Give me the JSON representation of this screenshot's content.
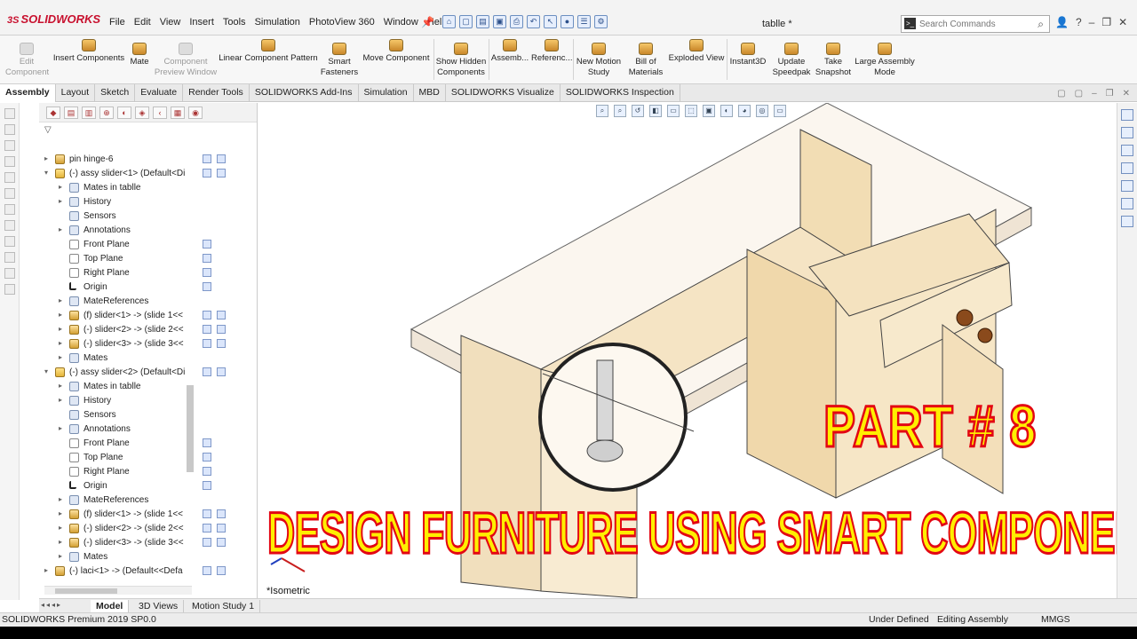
{
  "app": {
    "logo": "SOLIDWORKS",
    "menu": [
      "File",
      "Edit",
      "View",
      "Insert",
      "Tools",
      "Simulation",
      "PhotoView 360",
      "Window",
      "Help"
    ],
    "doc_title": "tablle *",
    "search_placeholder": "Search Commands"
  },
  "ribbon": {
    "edit_component": "Edit\nComponent",
    "insert_components": "Insert Components",
    "mate": "Mate",
    "component_preview": "Component\nPreview Window",
    "linear_pattern": "Linear Component Pattern",
    "smart_fasteners": "Smart\nFasteners",
    "move_component": "Move Component",
    "show_hidden": "Show Hidden\nComponents",
    "assembly": "Assemb...",
    "reference": "Referenc...",
    "new_motion": "New Motion\nStudy",
    "bom": "Bill of\nMaterials",
    "exploded_view": "Exploded View",
    "instant3d": "Instant3D",
    "update_speedpak": "Update\nSpeedpak",
    "take_snapshot": "Take\nSnapshot",
    "large_assembly": "Large Assembly\nMode"
  },
  "tabs": [
    "Assembly",
    "Layout",
    "Sketch",
    "Evaluate",
    "Render Tools",
    "SOLIDWORKS Add-Ins",
    "Simulation",
    "MBD",
    "SOLIDWORKS Visualize",
    "SOLIDWORKS Inspection"
  ],
  "tree": [
    {
      "label": "pin hinge-6",
      "indent": 0,
      "icon": "part",
      "tw": "▸"
    },
    {
      "label": "(-) assy slider<1> (Default<Di",
      "indent": 0,
      "icon": "asm",
      "tw": "▾"
    },
    {
      "label": "Mates in tablle",
      "indent": 1,
      "icon": "folder",
      "tw": "▸"
    },
    {
      "label": "History",
      "indent": 1,
      "icon": "folder",
      "tw": "▸"
    },
    {
      "label": "Sensors",
      "indent": 1,
      "icon": "folder",
      "tw": ""
    },
    {
      "label": "Annotations",
      "indent": 1,
      "icon": "folder",
      "tw": "▸"
    },
    {
      "label": "Front Plane",
      "indent": 1,
      "icon": "plane",
      "tw": ""
    },
    {
      "label": "Top Plane",
      "indent": 1,
      "icon": "plane",
      "tw": ""
    },
    {
      "label": "Right Plane",
      "indent": 1,
      "icon": "plane",
      "tw": ""
    },
    {
      "label": "Origin",
      "indent": 1,
      "icon": "origin",
      "tw": ""
    },
    {
      "label": "MateReferences",
      "indent": 1,
      "icon": "folder",
      "tw": "▸"
    },
    {
      "label": "(f) slider<1> -> (slide 1<<",
      "indent": 1,
      "icon": "part",
      "tw": "▸"
    },
    {
      "label": "(-) slider<2> -> (slide 2<<",
      "indent": 1,
      "icon": "part",
      "tw": "▸"
    },
    {
      "label": "(-) slider<3> -> (slide 3<<",
      "indent": 1,
      "icon": "part",
      "tw": "▸"
    },
    {
      "label": "Mates",
      "indent": 1,
      "icon": "folder",
      "tw": "▸"
    },
    {
      "label": "(-) assy slider<2> (Default<Di",
      "indent": 0,
      "icon": "asm",
      "tw": "▾"
    },
    {
      "label": "Mates in tablle",
      "indent": 1,
      "icon": "folder",
      "tw": "▸"
    },
    {
      "label": "History",
      "indent": 1,
      "icon": "folder",
      "tw": "▸"
    },
    {
      "label": "Sensors",
      "indent": 1,
      "icon": "folder",
      "tw": ""
    },
    {
      "label": "Annotations",
      "indent": 1,
      "icon": "folder",
      "tw": "▸"
    },
    {
      "label": "Front Plane",
      "indent": 1,
      "icon": "plane",
      "tw": ""
    },
    {
      "label": "Top Plane",
      "indent": 1,
      "icon": "plane",
      "tw": ""
    },
    {
      "label": "Right Plane",
      "indent": 1,
      "icon": "plane",
      "tw": ""
    },
    {
      "label": "Origin",
      "indent": 1,
      "icon": "origin",
      "tw": ""
    },
    {
      "label": "MateReferences",
      "indent": 1,
      "icon": "folder",
      "tw": "▸"
    },
    {
      "label": "(f) slider<1> -> (slide 1<<",
      "indent": 1,
      "icon": "part",
      "tw": "▸"
    },
    {
      "label": "(-) slider<2> -> (slide 2<<",
      "indent": 1,
      "icon": "part",
      "tw": "▸"
    },
    {
      "label": "(-) slider<3> -> (slide 3<<",
      "indent": 1,
      "icon": "part",
      "tw": "▸"
    },
    {
      "label": "Mates",
      "indent": 1,
      "icon": "folder",
      "tw": "▸"
    },
    {
      "label": "(-) laci<1> -> (Default<<Defa",
      "indent": 0,
      "icon": "part",
      "tw": "▸"
    }
  ],
  "graphics": {
    "view_label": "*Isometric",
    "overlay_part": "PART # 8",
    "overlay_title": "DESIGN FURNITURE USING SMART COMPONENT"
  },
  "bottom_tabs": [
    "Model",
    "3D Views",
    "Motion Study 1"
  ],
  "status": {
    "product": "SOLIDWORKS Premium 2019 SP0.0",
    "state": "Under Defined",
    "mode": "Editing Assembly",
    "units": "MMGS"
  },
  "colors": {
    "overlay_fill": "#ffef00",
    "overlay_stroke": "#e30613",
    "wood": "#f3e1bf"
  }
}
